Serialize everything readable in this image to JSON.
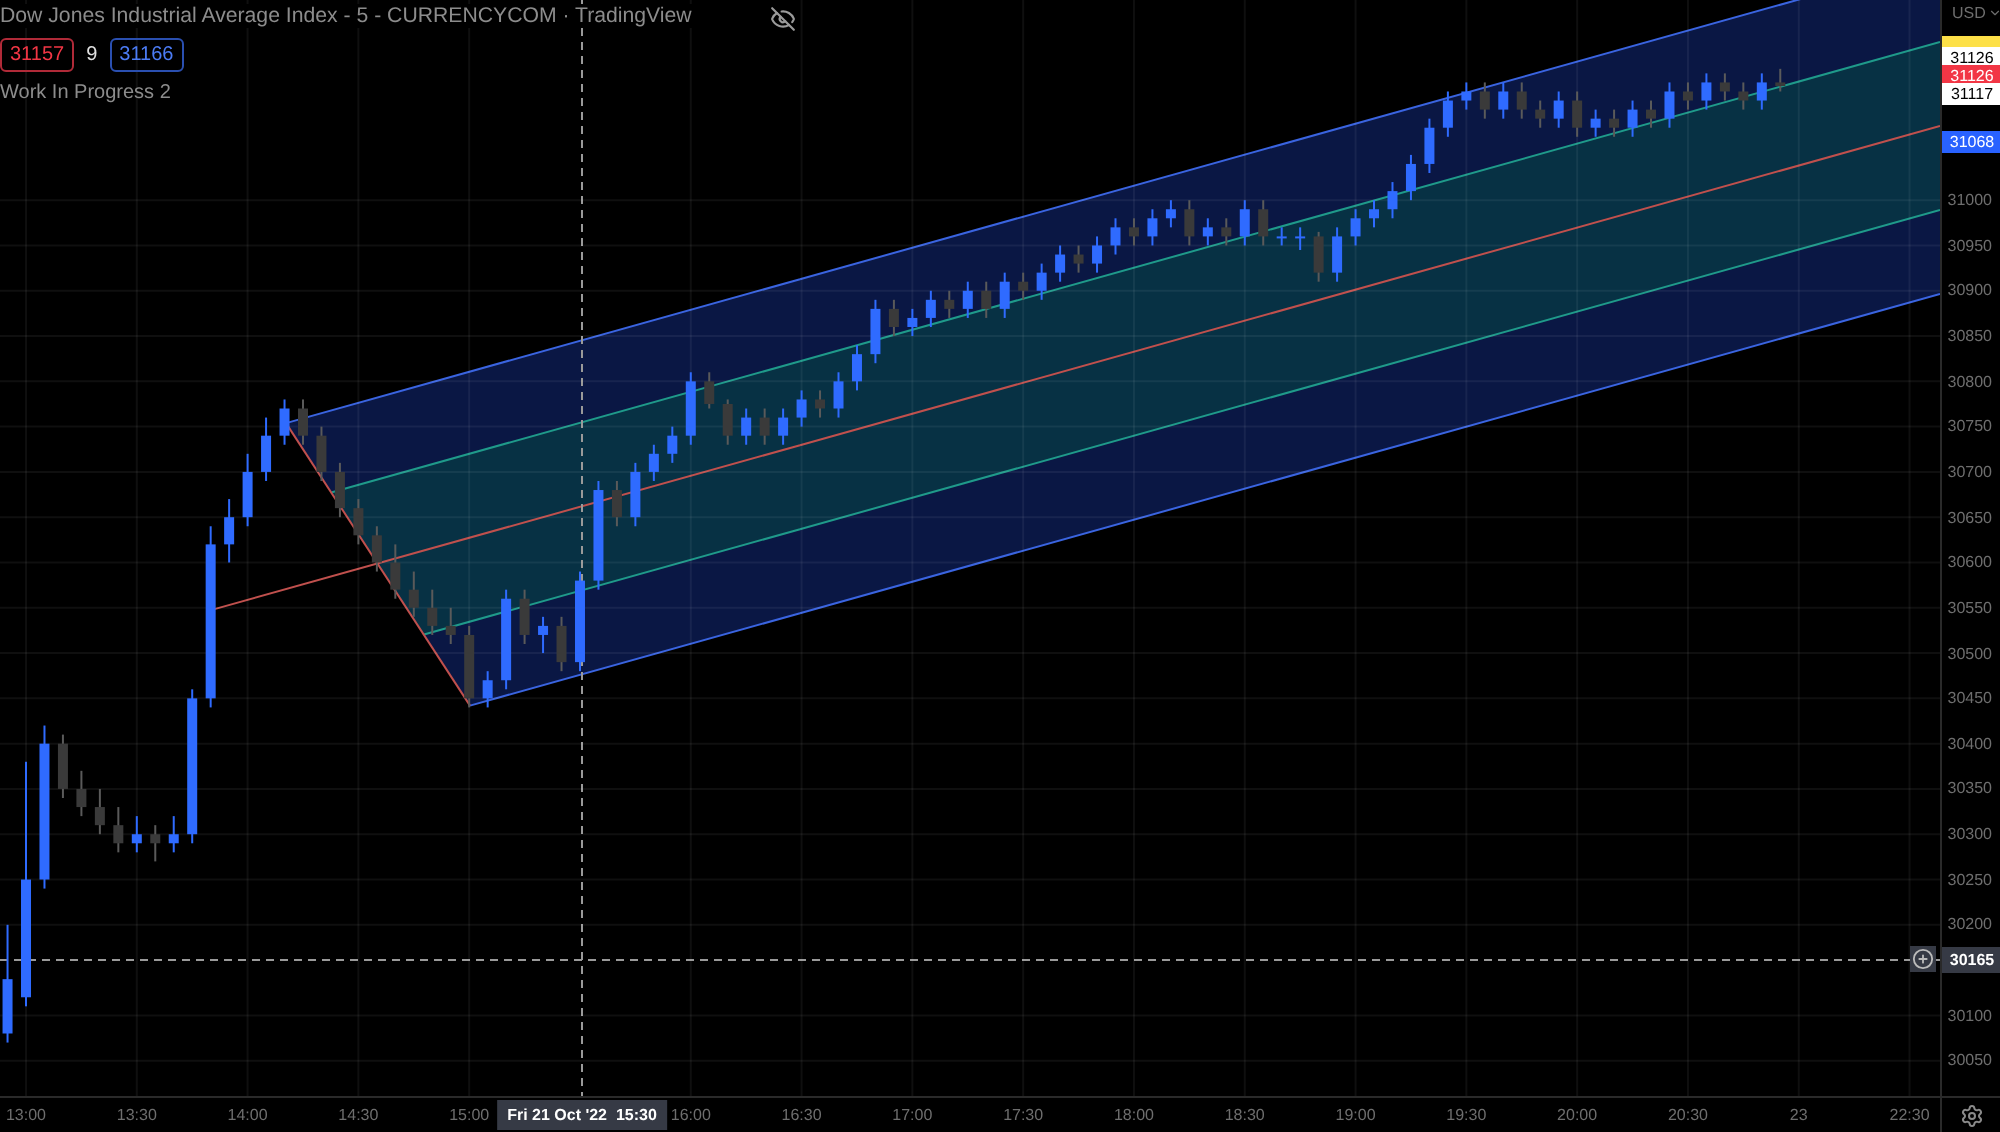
{
  "legend": {
    "title": "Dow Jones Industrial Average Index - 5 - CURRENCYCOM · TradingView",
    "quotes": [
      {
        "kind": "sell",
        "text": "31157"
      },
      {
        "kind": "spread",
        "text": "9"
      },
      {
        "kind": "buy",
        "text": "31166"
      }
    ],
    "indicator": "Work In Progress 2"
  },
  "chart_data": {
    "type": "candlestick",
    "categories": [
      null,
      "13:00",
      null,
      null,
      null,
      null,
      null,
      "13:30",
      null,
      null,
      null,
      null,
      null,
      "14:00",
      null,
      null,
      null,
      null,
      null,
      "14:30",
      null,
      null,
      null,
      null,
      null,
      "15:00",
      null,
      null,
      null,
      null,
      null,
      null,
      null,
      null,
      null,
      null,
      null,
      "16:00",
      null,
      null,
      null,
      null,
      null,
      "16:30",
      null,
      null,
      null,
      null,
      null,
      "17:00",
      null,
      null,
      null,
      null,
      null,
      "17:30",
      null,
      null,
      null,
      null,
      null,
      "18:00",
      null,
      null,
      null,
      null,
      null,
      "18:30",
      null,
      null,
      null,
      null,
      null,
      "19:00",
      null,
      null,
      null,
      null,
      null,
      "19:30",
      null,
      null,
      null,
      null,
      null,
      "20:00",
      null,
      null,
      null,
      null,
      null,
      "20:30",
      null,
      null,
      null,
      null,
      null,
      "23",
      null,
      null,
      null,
      null,
      null,
      "22:30"
    ],
    "ylim": [
      30011,
      31221
    ],
    "grid": true,
    "yticks": [
      31000,
      30950,
      30900,
      30850,
      30800,
      30750,
      30700,
      30650,
      30600,
      30550,
      30500,
      30450,
      30400,
      30350,
      30300,
      30250,
      30200,
      30100,
      30050
    ],
    "ohlc": [
      [
        30080,
        30200,
        30070,
        30140
      ],
      [
        30120,
        30380,
        30110,
        30250
      ],
      [
        30250,
        30420,
        30240,
        30400
      ],
      [
        30400,
        30410,
        30340,
        30350
      ],
      [
        30350,
        30370,
        30320,
        30330
      ],
      [
        30330,
        30350,
        30300,
        30310
      ],
      [
        30310,
        30330,
        30280,
        30290
      ],
      [
        30290,
        30320,
        30280,
        30300
      ],
      [
        30300,
        30310,
        30270,
        30290
      ],
      [
        30290,
        30320,
        30280,
        30300
      ],
      [
        30300,
        30460,
        30290,
        30450
      ],
      [
        30450,
        30640,
        30440,
        30620
      ],
      [
        30620,
        30670,
        30600,
        30650
      ],
      [
        30650,
        30720,
        30640,
        30700
      ],
      [
        30700,
        30760,
        30690,
        30740
      ],
      [
        30740,
        30780,
        30730,
        30770
      ],
      [
        30770,
        30780,
        30730,
        30740
      ],
      [
        30740,
        30750,
        30690,
        30700
      ],
      [
        30700,
        30710,
        30650,
        30660
      ],
      [
        30660,
        30670,
        30620,
        30630
      ],
      [
        30630,
        30640,
        30590,
        30600
      ],
      [
        30600,
        30620,
        30560,
        30570
      ],
      [
        30570,
        30590,
        30540,
        30550
      ],
      [
        30550,
        30570,
        30520,
        30530
      ],
      [
        30530,
        30550,
        30510,
        30520
      ],
      [
        30520,
        30530,
        30440,
        30450
      ],
      [
        30450,
        30480,
        30440,
        30470
      ],
      [
        30470,
        30570,
        30460,
        30560
      ],
      [
        30560,
        30570,
        30510,
        30520
      ],
      [
        30520,
        30540,
        30500,
        30530
      ],
      [
        30530,
        30540,
        30480,
        30490
      ],
      [
        30490,
        30590,
        30480,
        30580
      ],
      [
        30580,
        30690,
        30570,
        30680
      ],
      [
        30680,
        30690,
        30640,
        30650
      ],
      [
        30650,
        30710,
        30640,
        30700
      ],
      [
        30700,
        30730,
        30690,
        30720
      ],
      [
        30720,
        30750,
        30710,
        30740
      ],
      [
        30740,
        30810,
        30730,
        30800
      ],
      [
        30800,
        30810,
        30770,
        30775
      ],
      [
        30775,
        30780,
        30730,
        30740
      ],
      [
        30740,
        30770,
        30730,
        30760
      ],
      [
        30760,
        30770,
        30730,
        30740
      ],
      [
        30740,
        30770,
        30730,
        30760
      ],
      [
        30760,
        30790,
        30750,
        30780
      ],
      [
        30780,
        30790,
        30760,
        30770
      ],
      [
        30770,
        30810,
        30760,
        30800
      ],
      [
        30800,
        30840,
        30790,
        30830
      ],
      [
        30830,
        30890,
        30820,
        30880
      ],
      [
        30880,
        30890,
        30850,
        30860
      ],
      [
        30860,
        30880,
        30850,
        30870
      ],
      [
        30870,
        30900,
        30860,
        30890
      ],
      [
        30890,
        30900,
        30870,
        30880
      ],
      [
        30880,
        30910,
        30870,
        30900
      ],
      [
        30900,
        30910,
        30870,
        30880
      ],
      [
        30880,
        30920,
        30870,
        30910
      ],
      [
        30910,
        30920,
        30890,
        30900
      ],
      [
        30900,
        30930,
        30890,
        30920
      ],
      [
        30920,
        30950,
        30910,
        30940
      ],
      [
        30940,
        30950,
        30920,
        30930
      ],
      [
        30930,
        30960,
        30920,
        30950
      ],
      [
        30950,
        30980,
        30940,
        30970
      ],
      [
        30970,
        30980,
        30950,
        30960
      ],
      [
        30960,
        30990,
        30950,
        30980
      ],
      [
        30980,
        31000,
        30970,
        30990
      ],
      [
        30990,
        31000,
        30950,
        30960
      ],
      [
        30960,
        30980,
        30950,
        30970
      ],
      [
        30970,
        30980,
        30950,
        30960
      ],
      [
        30960,
        31000,
        30950,
        30990
      ],
      [
        30990,
        31000,
        30950,
        30960
      ],
      [
        30960,
        30970,
        30950,
        30960
      ],
      [
        30960,
        30970,
        30945,
        30960
      ],
      [
        30960,
        30965,
        30910,
        30920
      ],
      [
        30920,
        30970,
        30910,
        30960
      ],
      [
        30960,
        30990,
        30950,
        30980
      ],
      [
        30980,
        31000,
        30970,
        30990
      ],
      [
        30990,
        31020,
        30980,
        31010
      ],
      [
        31010,
        31050,
        31000,
        31040
      ],
      [
        31040,
        31090,
        31030,
        31080
      ],
      [
        31080,
        31120,
        31070,
        31110
      ],
      [
        31110,
        31130,
        31100,
        31120
      ],
      [
        31120,
        31130,
        31090,
        31100
      ],
      [
        31100,
        31130,
        31090,
        31120
      ],
      [
        31120,
        31130,
        31090,
        31100
      ],
      [
        31100,
        31110,
        31080,
        31090
      ],
      [
        31090,
        31120,
        31080,
        31110
      ],
      [
        31110,
        31120,
        31070,
        31080
      ],
      [
        31080,
        31100,
        31070,
        31090
      ],
      [
        31090,
        31100,
        31070,
        31080
      ],
      [
        31080,
        31110,
        31070,
        31100
      ],
      [
        31100,
        31110,
        31080,
        31090
      ],
      [
        31090,
        31130,
        31080,
        31120
      ],
      [
        31120,
        31130,
        31100,
        31110
      ],
      [
        31110,
        31140,
        31100,
        31130
      ],
      [
        31130,
        31140,
        31110,
        31120
      ],
      [
        31120,
        31130,
        31100,
        31110
      ],
      [
        31110,
        31140,
        31100,
        31130
      ],
      [
        31130,
        31145,
        31120,
        31126
      ],
      null,
      null,
      null,
      null,
      null,
      null,
      null
    ]
  },
  "price_axis": {
    "currency": "USD",
    "labels": [
      {
        "text": "31126",
        "color": "#ffffff"
      },
      {
        "text": "31126",
        "color": "#f23645"
      },
      {
        "text": "31117",
        "color": "#ffffff"
      },
      {
        "text": "31068",
        "color": "#2962ff"
      }
    ]
  },
  "crosshair": {
    "price": "30165",
    "time": "Fri 21 Oct '22  15:30"
  }
}
